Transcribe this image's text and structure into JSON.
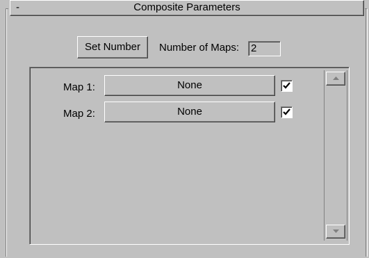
{
  "rollout": {
    "collapse_symbol": "-",
    "title": "Composite Parameters"
  },
  "controls": {
    "set_number_label": "Set Number",
    "num_maps_label": "Number of Maps:",
    "num_maps_value": "2"
  },
  "maps": [
    {
      "label": "Map 1:",
      "button": "None",
      "enabled": true
    },
    {
      "label": "Map 2:",
      "button": "None",
      "enabled": true
    }
  ],
  "icons": {
    "checkbox": "checkmark-icon",
    "scroll_up": "triangle-up-icon",
    "scroll_down": "triangle-down-icon"
  }
}
